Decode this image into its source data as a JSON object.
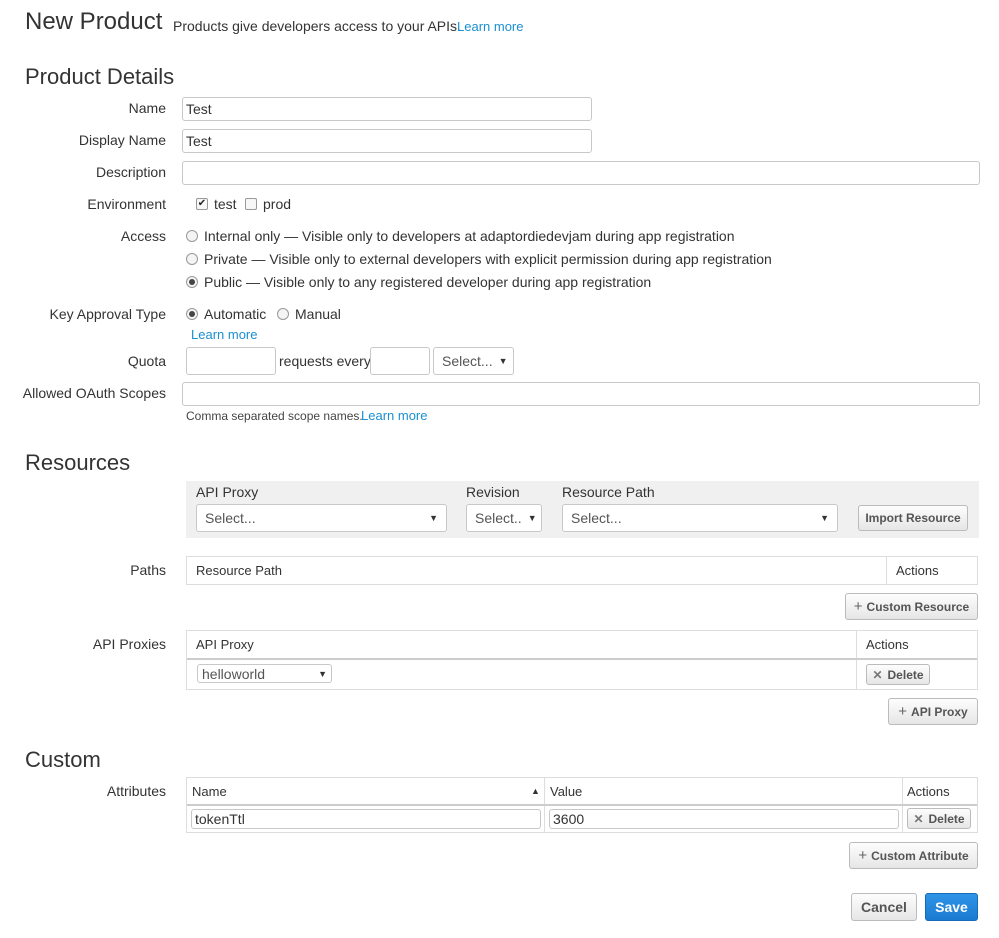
{
  "header": {
    "title": "New Product",
    "subtitle": "Products give developers access to your APIs.",
    "learn_more": "Learn more"
  },
  "details": {
    "section_title": "Product Details",
    "name": {
      "label": "Name",
      "value": "Test"
    },
    "display_name": {
      "label": "Display Name",
      "value": "Test"
    },
    "description": {
      "label": "Description",
      "value": ""
    },
    "environment": {
      "label": "Environment",
      "options": [
        {
          "label": "test",
          "checked": true
        },
        {
          "label": "prod",
          "checked": false
        }
      ]
    },
    "access": {
      "label": "Access",
      "options": [
        {
          "label": "Internal only — Visible only to developers at adaptordiedevjam during app registration",
          "selected": false
        },
        {
          "label": "Private — Visible only to external developers with explicit permission during app registration",
          "selected": false
        },
        {
          "label": "Public — Visible only to any registered developer during app registration",
          "selected": true
        }
      ]
    },
    "key_approval": {
      "label": "Key Approval Type",
      "options": [
        {
          "label": "Automatic",
          "selected": true
        },
        {
          "label": "Manual",
          "selected": false
        }
      ],
      "learn_more": "Learn more"
    },
    "quota": {
      "label": "Quota",
      "count_value": "",
      "requests_every": "requests every",
      "interval_value": "",
      "unit_select": "Select..."
    },
    "oauth": {
      "label": "Allowed OAuth Scopes",
      "value": "",
      "hint": "Comma separated scope names.",
      "learn_more": "Learn more"
    }
  },
  "resources": {
    "section_title": "Resources",
    "api_proxy_label": "API Proxy",
    "api_proxy_select": "Select...",
    "revision_label": "Revision",
    "revision_select": "Select..",
    "resource_path_label": "Resource Path",
    "resource_path_select": "Select...",
    "import_button": "Import Resource",
    "paths": {
      "label": "Paths",
      "columns": [
        "Resource Path",
        "Actions"
      ],
      "add_button": "Custom Resource"
    },
    "api_proxies": {
      "label": "API Proxies",
      "columns": [
        "API Proxy",
        "Actions"
      ],
      "rows": [
        {
          "proxy": "helloworld",
          "delete": "Delete"
        }
      ],
      "add_button": "API Proxy"
    }
  },
  "custom": {
    "section_title": "Custom",
    "attributes": {
      "label": "Attributes",
      "columns": [
        "Name",
        "Value",
        "Actions"
      ],
      "rows": [
        {
          "name": "tokenTtl",
          "value": "3600",
          "delete": "Delete"
        }
      ],
      "add_button": "Custom Attribute"
    }
  },
  "footer": {
    "cancel": "Cancel",
    "save": "Save"
  },
  "colors": {
    "link": "#1a8fd0",
    "primary": "#1b7bd2"
  }
}
